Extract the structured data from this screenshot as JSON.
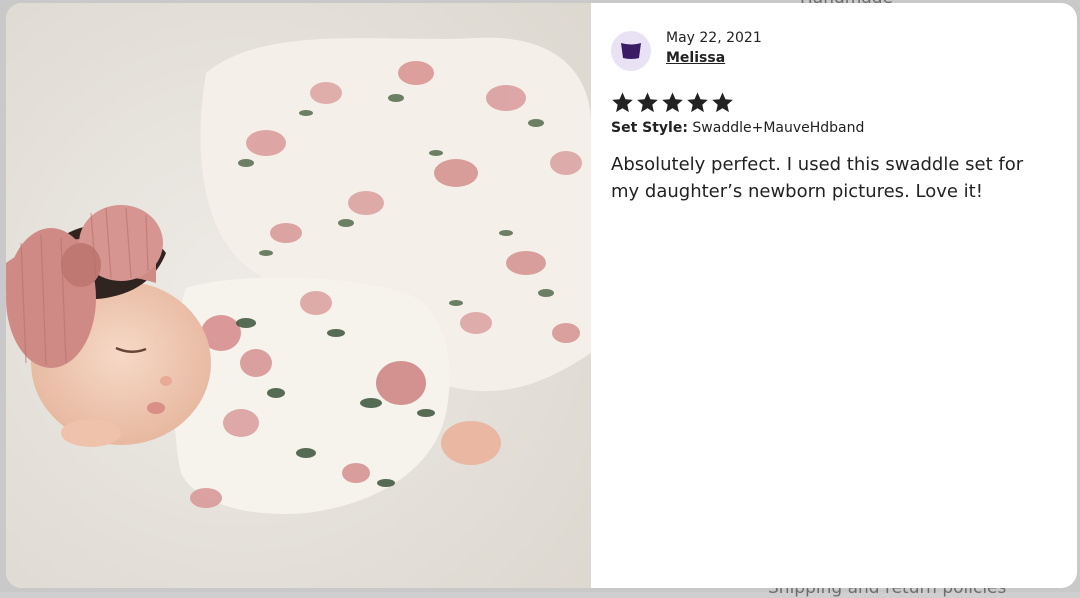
{
  "background": {
    "peek_top": "Handmade",
    "peek_bottom": "Shipping and return policies"
  },
  "photo": {
    "alt": "Newborn baby in floral swaddle with mauve headband"
  },
  "review": {
    "date": "May 22, 2021",
    "author": "Melissa",
    "rating": 5,
    "rating_max": 5,
    "variation_label": "Set Style:",
    "variation_value": "Swaddle+MauveHdband",
    "text": "Absolutely perfect. I used this swaddle set for my daughter’s newborn pictures. Love it!"
  },
  "colors": {
    "avatar_bg": "#e9e2f4",
    "avatar_icon": "#3b1b63",
    "star": "#222222"
  }
}
